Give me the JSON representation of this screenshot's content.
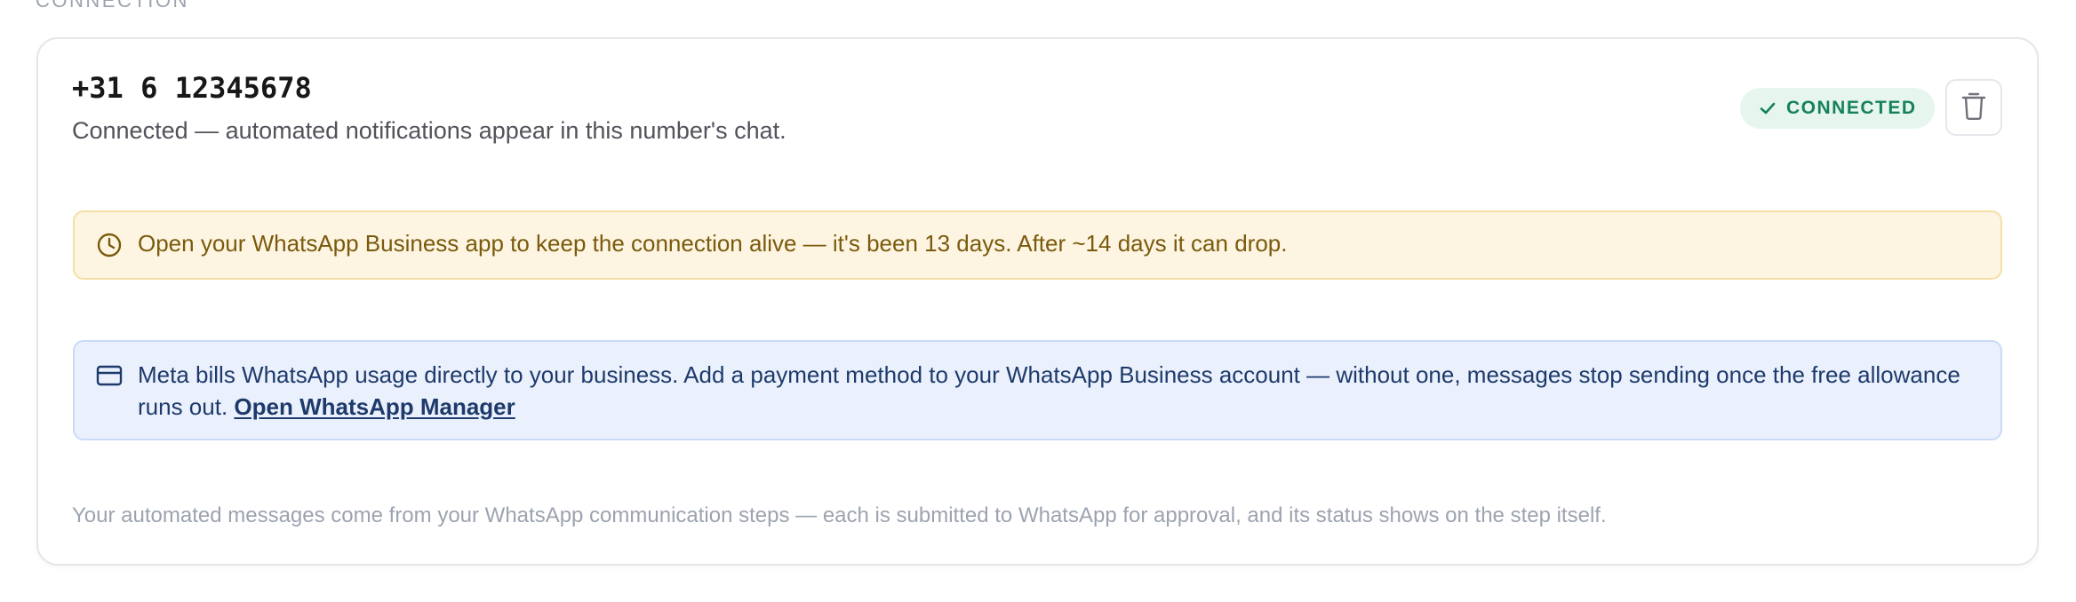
{
  "section": {
    "label": "CONNECTION"
  },
  "connection": {
    "phone_number": "+31 6 12345678",
    "status_description": "Connected — automated notifications appear in this number's chat.",
    "badge_label": "CONNECTED",
    "badge_icon": "check-icon",
    "delete_icon": "trash-icon"
  },
  "warning_alert": {
    "icon": "clock-icon",
    "text": "Open your WhatsApp Business app to keep the connection alive — it's been 13 days. After ~14 days it can drop."
  },
  "billing_alert": {
    "icon": "credit-card-icon",
    "text": "Meta bills WhatsApp usage directly to your business. Add a payment method to your WhatsApp Business account — without one, messages stop sending once the free allowance runs out.",
    "link_label": "Open WhatsApp Manager"
  },
  "footnote": {
    "text": "Your automated messages come from your WhatsApp communication steps — each is submitted to WhatsApp for approval, and its status shows on the step itself."
  },
  "colors": {
    "success": "#17825a",
    "success_bg": "#e6f6ef",
    "warning_bg": "#fdf5e2",
    "warning_text": "#7a5a0c",
    "info_bg": "#eaf1fd",
    "info_text": "#1e3a6b"
  }
}
